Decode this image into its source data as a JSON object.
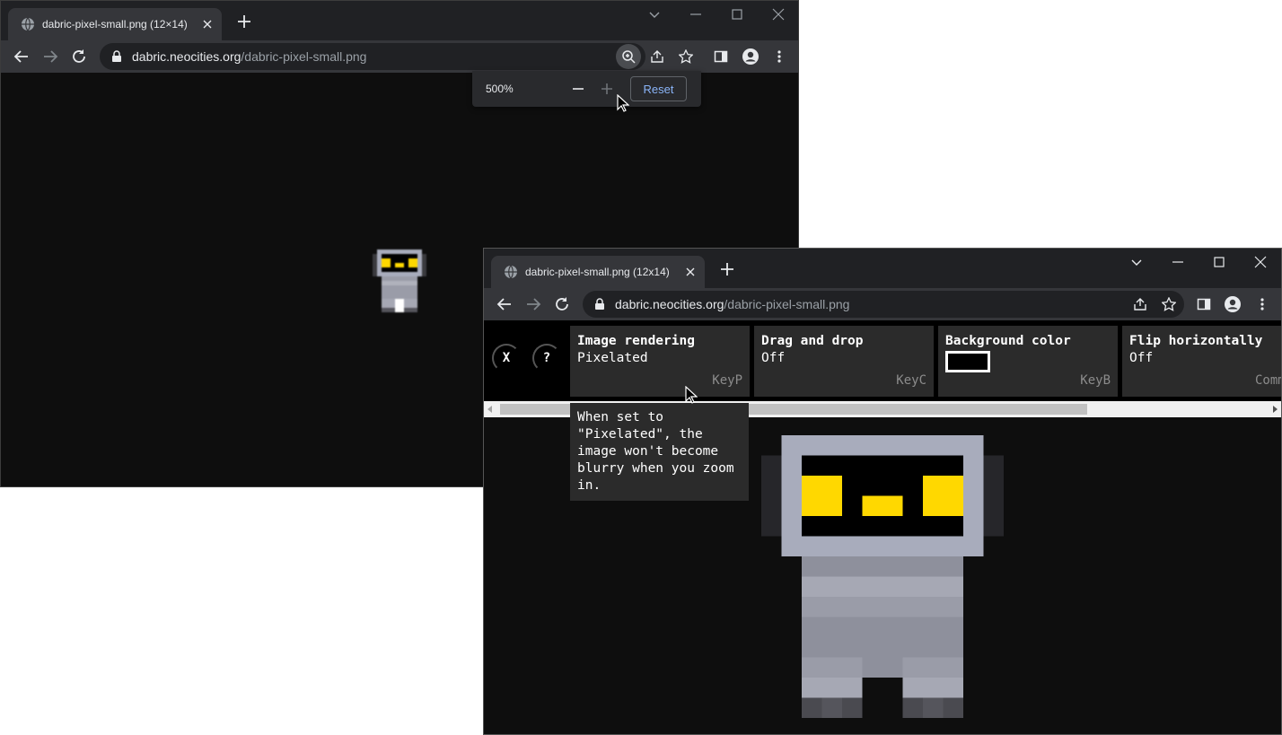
{
  "back_window": {
    "tab_title": "dabric-pixel-small.png (12×14)",
    "url_host": "dabric.neocities.org",
    "url_path": "/dabric-pixel-small.png",
    "zoom_popup": {
      "level": "500%",
      "reset_label": "Reset"
    }
  },
  "front_window": {
    "tab_title": "dabric-pixel-small.png (12x14)",
    "url_host": "dabric.neocities.org",
    "url_path": "/dabric-pixel-small.png",
    "settings": {
      "close_label": "X",
      "help_label": "?",
      "cards": [
        {
          "label": "Image rendering",
          "value": "Pixelated",
          "key": "KeyP"
        },
        {
          "label": "Drag and drop",
          "value": "Off",
          "key": "KeyC"
        },
        {
          "label": "Background color",
          "value": "",
          "key": "KeyB",
          "swatch": "#000000"
        },
        {
          "label": "Flip horizontally",
          "value": "Off",
          "key": "Comma"
        }
      ],
      "tooltip": "When set to \"Pixelated\", the image won't become blurry when you zoom in."
    }
  },
  "colors": {
    "robot_frame": "#a8acbc",
    "robot_eye": "#ffd800",
    "robot_visor": "#000000",
    "robot_body": "#9a9ca8"
  }
}
